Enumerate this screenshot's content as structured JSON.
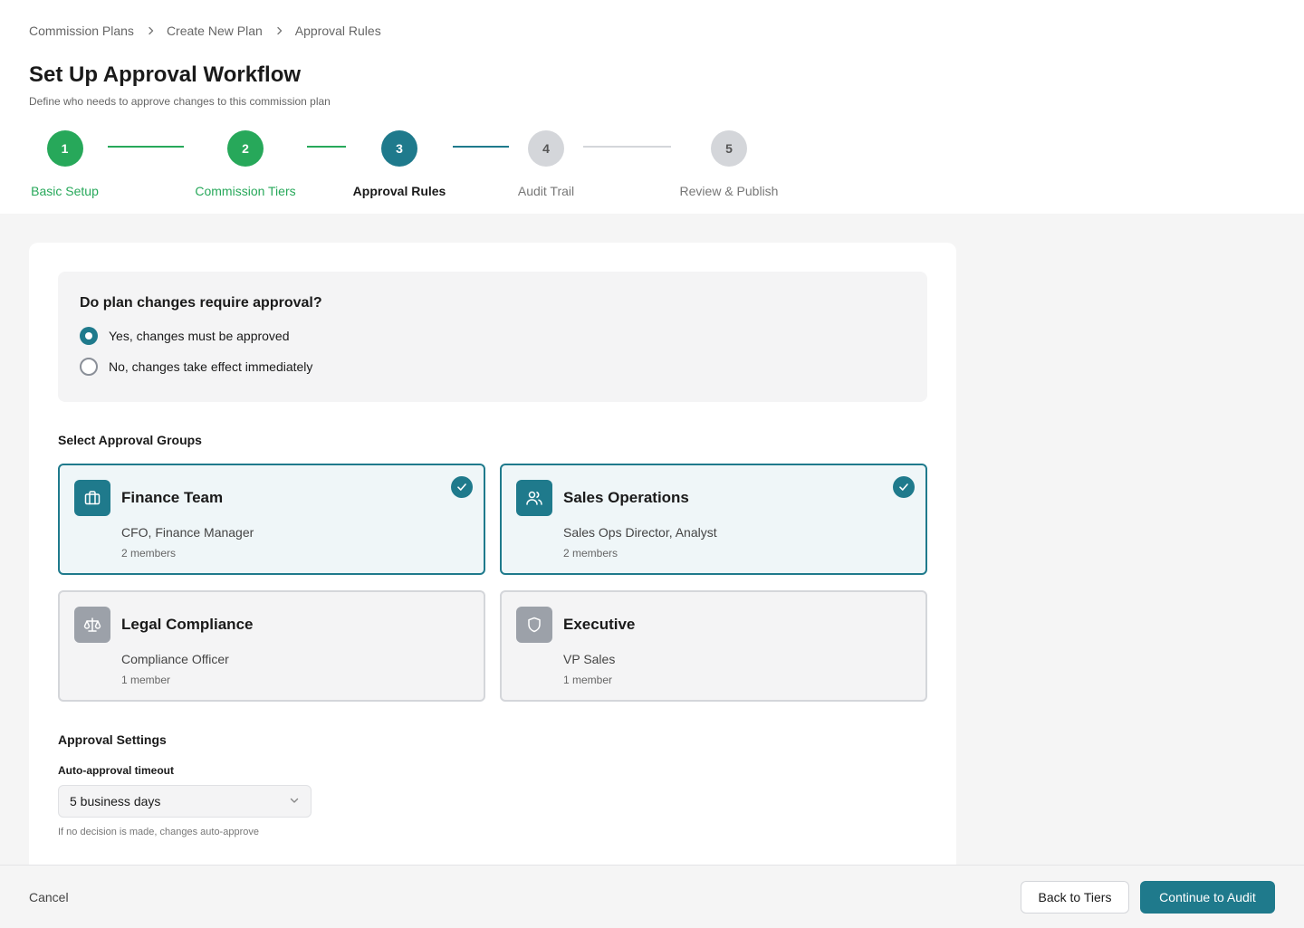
{
  "breadcrumb": {
    "items": [
      "Commission Plans",
      "Create New Plan",
      "Approval Rules"
    ]
  },
  "header": {
    "title": "Set Up Approval Workflow",
    "subtitle": "Define who needs to approve changes to this commission plan"
  },
  "stepper": {
    "steps": [
      {
        "number": "1",
        "label": "Basic Setup",
        "state": "done"
      },
      {
        "number": "2",
        "label": "Commission Tiers",
        "state": "done"
      },
      {
        "number": "3",
        "label": "Approval Rules",
        "state": "active"
      },
      {
        "number": "4",
        "label": "Audit Trail",
        "state": "pending"
      },
      {
        "number": "5",
        "label": "Review & Publish",
        "state": "pending"
      }
    ]
  },
  "approval_question": {
    "title": "Do plan changes require approval?",
    "options": [
      {
        "label": "Yes, changes must be approved",
        "selected": true
      },
      {
        "label": "No, changes take effect immediately",
        "selected": false
      }
    ]
  },
  "groups": {
    "title": "Select Approval Groups",
    "items": [
      {
        "name": "Finance Team",
        "members": "CFO, Finance Manager",
        "count": "2 members",
        "selected": true,
        "icon": "briefcase-icon"
      },
      {
        "name": "Sales Operations",
        "members": "Sales Ops Director, Analyst",
        "count": "2 members",
        "selected": true,
        "icon": "users-icon"
      },
      {
        "name": "Legal Compliance",
        "members": "Compliance Officer",
        "count": "1 member",
        "selected": false,
        "icon": "scale-icon"
      },
      {
        "name": "Executive",
        "members": "VP Sales",
        "count": "1 member",
        "selected": false,
        "icon": "shield-icon"
      }
    ]
  },
  "settings": {
    "title": "Approval Settings",
    "timeout_label": "Auto-approval timeout",
    "timeout_value": "5 business days",
    "helper": "If no decision is made, changes auto-approve"
  },
  "footer": {
    "cancel_label": "Cancel",
    "back_label": "Back to Tiers",
    "continue_label": "Continue to Audit"
  },
  "colors": {
    "accent": "#1f7a8c",
    "success": "#27a85a",
    "pending": "#d4d6da"
  }
}
